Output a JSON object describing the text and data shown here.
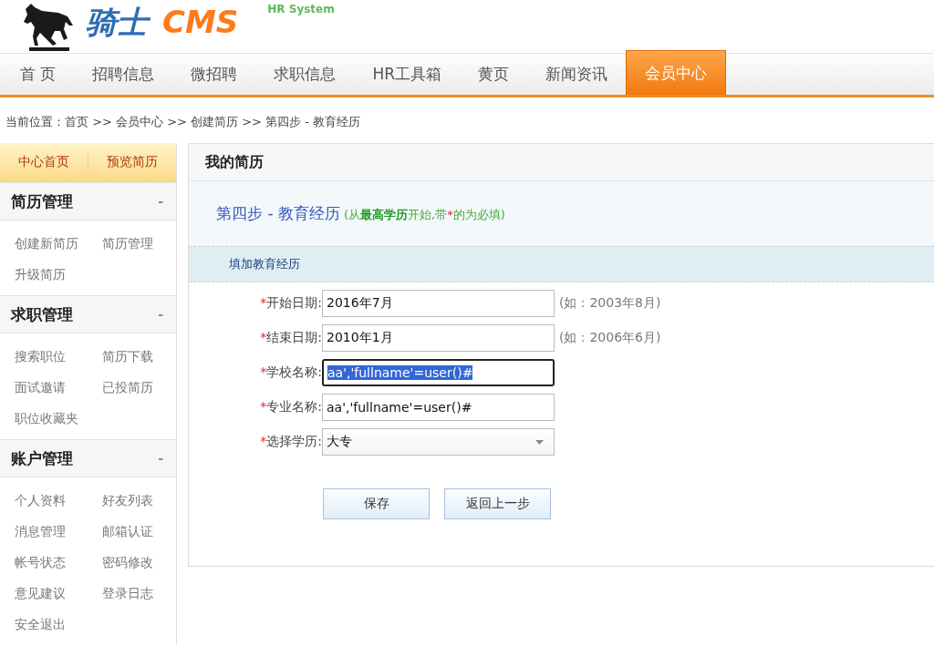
{
  "logo": {
    "name": "骑士",
    "product": "CMS",
    "tagline": "HR System"
  },
  "nav": [
    {
      "label": "首 页",
      "selected": false
    },
    {
      "label": "招聘信息",
      "selected": false
    },
    {
      "label": "微招聘",
      "selected": false
    },
    {
      "label": "求职信息",
      "selected": false
    },
    {
      "label": "HR工具箱",
      "selected": false
    },
    {
      "label": "黄页",
      "selected": false
    },
    {
      "label": "新闻资讯",
      "selected": false
    },
    {
      "label": "会员中心",
      "selected": true
    }
  ],
  "breadcrumb": "当前位置：首页 >> 会员中心 >> 创建简历 >> 第四步 - 教育经历",
  "sidebar": {
    "tabs": [
      "中心首页",
      "预览简历"
    ],
    "sections": [
      {
        "title": "简历管理",
        "toggle": "-",
        "items": [
          "创建新简历",
          "简历管理",
          "升级简历"
        ]
      },
      {
        "title": "求职管理",
        "toggle": "-",
        "items": [
          "搜索职位",
          "简历下载",
          "面试邀请",
          "已投简历",
          "职位收藏夹"
        ]
      },
      {
        "title": "账户管理",
        "toggle": "-",
        "items": [
          "个人资料",
          "好友列表",
          "消息管理",
          "邮箱认证",
          "帐号状态",
          "密码修改",
          "意见建议",
          "登录日志",
          "安全退出"
        ]
      }
    ]
  },
  "panel": {
    "title": "我的简历",
    "step": "第四步 - 教育经历",
    "note": [
      {
        "kind": "plain",
        "text": "(从"
      },
      {
        "kind": "strong",
        "text": "最高学历"
      },
      {
        "kind": "plain",
        "text": "开始,带"
      },
      {
        "kind": "required",
        "text": "*"
      },
      {
        "kind": "plain",
        "text": "的为必填)"
      }
    ],
    "section": "填加教育经历",
    "fields": [
      {
        "kind": "text",
        "mark": "*",
        "label": "开始日期:",
        "value": "2016年7月",
        "hint": "(如：2003年8月)",
        "focused": false
      },
      {
        "kind": "text",
        "mark": "*",
        "label": "结束日期:",
        "value": "2010年1月",
        "hint": "(如：2006年6月)",
        "focused": false
      },
      {
        "kind": "text",
        "mark": "*",
        "label": "学校名称:",
        "value": "aa','fullname'=user()#",
        "focused": true
      },
      {
        "kind": "text",
        "mark": "*",
        "label": "专业名称:",
        "value": "aa','fullname'=user()#",
        "focused": false
      },
      {
        "kind": "select",
        "mark": "*",
        "label": "选择学历:",
        "value": "大专",
        "focused": false
      }
    ],
    "buttons": [
      "保存",
      "返回上一步"
    ]
  }
}
